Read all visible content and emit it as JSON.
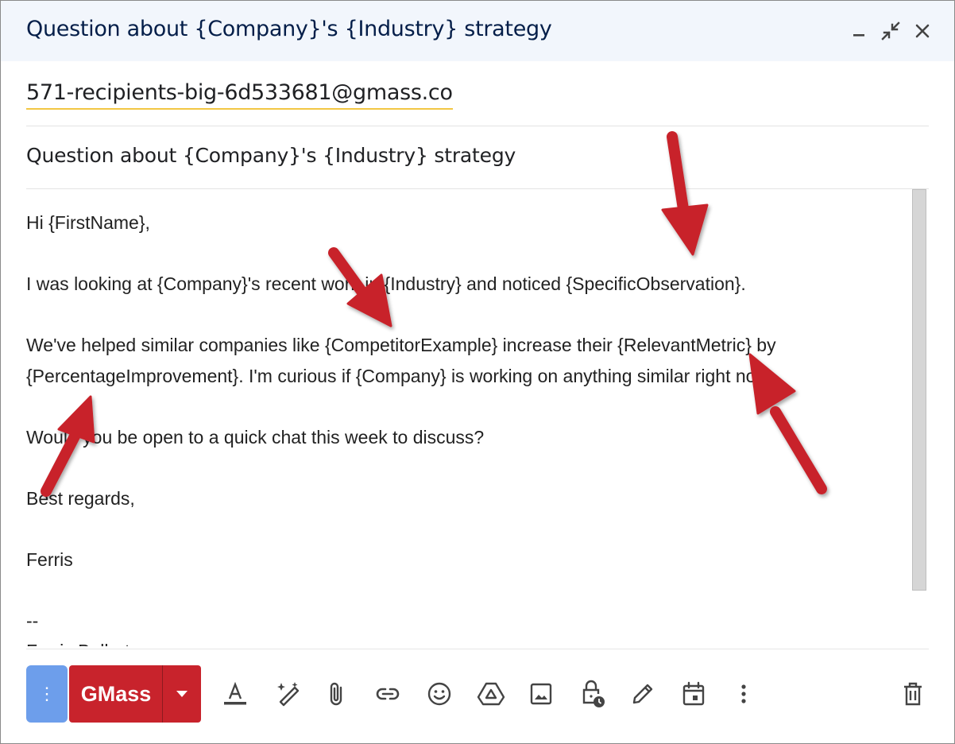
{
  "window": {
    "title": "Question about {Company}'s {Industry} strategy",
    "minimize_icon": "minimize-icon",
    "exit_fullscreen_icon": "exit-fullscreen-icon",
    "close_icon": "close-icon"
  },
  "recipient": {
    "value": "571-recipients-big-6d533681@gmass.co"
  },
  "subject": {
    "value": "Question about {Company}'s {Industry} strategy"
  },
  "body": {
    "lines": [
      "Hi {FirstName},",
      "",
      "I was looking at {Company}'s recent work in {Industry} and noticed {SpecificObservation}.",
      "",
      "We've helped similar companies like {CompetitorExample} increase their {RelevantMetric} by",
      "{PercentageImprovement}. I'm curious if {Company} is working on anything similar right now.",
      "",
      "Would you be open to a quick chat this week to discuss?",
      "",
      "Best regards,",
      "",
      "Ferris",
      "",
      "--",
      "Ferris Bollert"
    ]
  },
  "annotation_color": "#c8232c",
  "toolbar": {
    "more_options_label": "⋮",
    "gmass_label": "GMass",
    "icons": [
      "formatting-options-icon",
      "ai-assist-icon",
      "attach-file-icon",
      "insert-link-icon",
      "emoji-icon",
      "google-drive-icon",
      "insert-photo-icon",
      "confidential-mode-icon",
      "signature-icon",
      "schedule-event-icon",
      "more-options-icon",
      "discard-draft-icon"
    ]
  }
}
